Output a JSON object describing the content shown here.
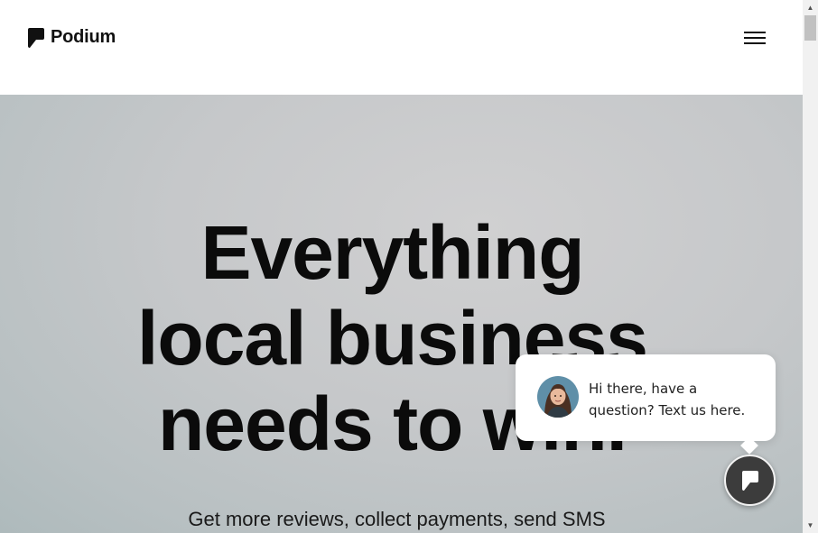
{
  "header": {
    "brand": "Podium",
    "menu_icon": "hamburger-menu-icon"
  },
  "hero": {
    "title_line1": "Everything",
    "title_line2": "local business",
    "title_line3": "needs to win.",
    "subtitle": "Get more reviews, collect payments, send SMS"
  },
  "chat": {
    "message": "Hi there, have a question? Text us here.",
    "avatar_icon": "agent-avatar-icon",
    "launcher_icon": "podium-chat-icon"
  },
  "colors": {
    "text": "#111111",
    "hero_bg": "#c6c8ca",
    "launcher_bg": "#3c3c3c"
  }
}
